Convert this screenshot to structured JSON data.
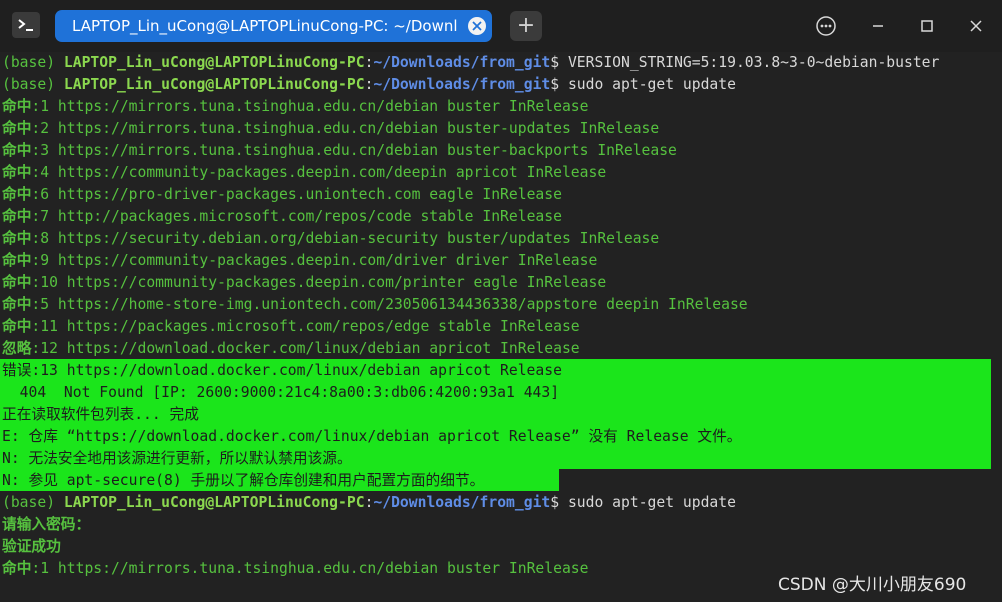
{
  "window": {
    "tab_title": "LAPTOP_Lin_uCong@LAPTOPLinuCong-PC: ~/Downloads/fr…",
    "new_tab_symbol": "+"
  },
  "prompt": {
    "env": "(base) ",
    "user_host": "LAPTOP_Lin_uCong@LAPTOPLinuCong-PC",
    "colon": ":",
    "path": "~/Downloads/from_git",
    "dollar": "$ "
  },
  "lines": [
    {
      "type": "prompt",
      "cmd": "VERSION_STRING=5:19.03.8~3-0~debian-buster"
    },
    {
      "type": "prompt",
      "cmd": "sudo apt-get update"
    },
    {
      "type": "hit",
      "label": "命中",
      "text": ":1 https://mirrors.tuna.tsinghua.edu.cn/debian buster InRelease"
    },
    {
      "type": "hit",
      "label": "命中",
      "text": ":2 https://mirrors.tuna.tsinghua.edu.cn/debian buster-updates InRelease"
    },
    {
      "type": "hit",
      "label": "命中",
      "text": ":3 https://mirrors.tuna.tsinghua.edu.cn/debian buster-backports InRelease"
    },
    {
      "type": "hit",
      "label": "命中",
      "text": ":4 https://community-packages.deepin.com/deepin apricot InRelease"
    },
    {
      "type": "hit",
      "label": "命中",
      "text": ":6 https://pro-driver-packages.uniontech.com eagle InRelease"
    },
    {
      "type": "hit",
      "label": "命中",
      "text": ":7 http://packages.microsoft.com/repos/code stable InRelease"
    },
    {
      "type": "hit",
      "label": "命中",
      "text": ":8 https://security.debian.org/debian-security buster/updates InRelease"
    },
    {
      "type": "hit",
      "label": "命中",
      "text": ":9 https://community-packages.deepin.com/driver driver InRelease"
    },
    {
      "type": "hit",
      "label": "命中",
      "text": ":10 https://community-packages.deepin.com/printer eagle InRelease"
    },
    {
      "type": "hit",
      "label": "命中",
      "text": ":5 https://home-store-img.uniontech.com/230506134436338/appstore deepin InRelease"
    },
    {
      "type": "hit",
      "label": "命中",
      "text": ":11 https://packages.microsoft.com/repos/edge stable InRelease"
    },
    {
      "type": "hit",
      "label": "忽略",
      "text": ":12 https://download.docker.com/linux/debian apricot InRelease"
    },
    {
      "type": "sel",
      "text": "错误:13 https://download.docker.com/linux/debian apricot Release"
    },
    {
      "type": "sel",
      "text": "  404  Not Found [IP: 2600:9000:21c4:8a00:3:db06:4200:93a1 443]"
    },
    {
      "type": "sel",
      "text": "正在读取软件包列表... 完成"
    },
    {
      "type": "sel",
      "text": "E: 仓库 “https://download.docker.com/linux/debian apricot Release” 没有 Release 文件。"
    },
    {
      "type": "sel",
      "text": "N: 无法安全地用该源进行更新，所以默认禁用该源。"
    },
    {
      "type": "sel",
      "text": "N: 参见 apt-secure(8) 手册以了解仓库创建和用户配置方面的细节。"
    },
    {
      "type": "prompt",
      "cmd": "sudo apt-get update"
    },
    {
      "type": "plain",
      "text": "请输入密码："
    },
    {
      "type": "plain",
      "text": "验证成功"
    },
    {
      "type": "hit",
      "label": "命中",
      "text": ":1 https://mirrors.tuna.tsinghua.edu.cn/debian buster InRelease"
    }
  ],
  "watermark": "CSDN @大川小朋友690",
  "colors": {
    "titlebar": "#1f1f1f",
    "tab_active": "#1f72d8",
    "terminal_bg": "#222222",
    "prompt_user": "#8bd84f",
    "prompt_path": "#5f8de6",
    "hit_text": "#56c13f",
    "selection": "#1be51b"
  }
}
